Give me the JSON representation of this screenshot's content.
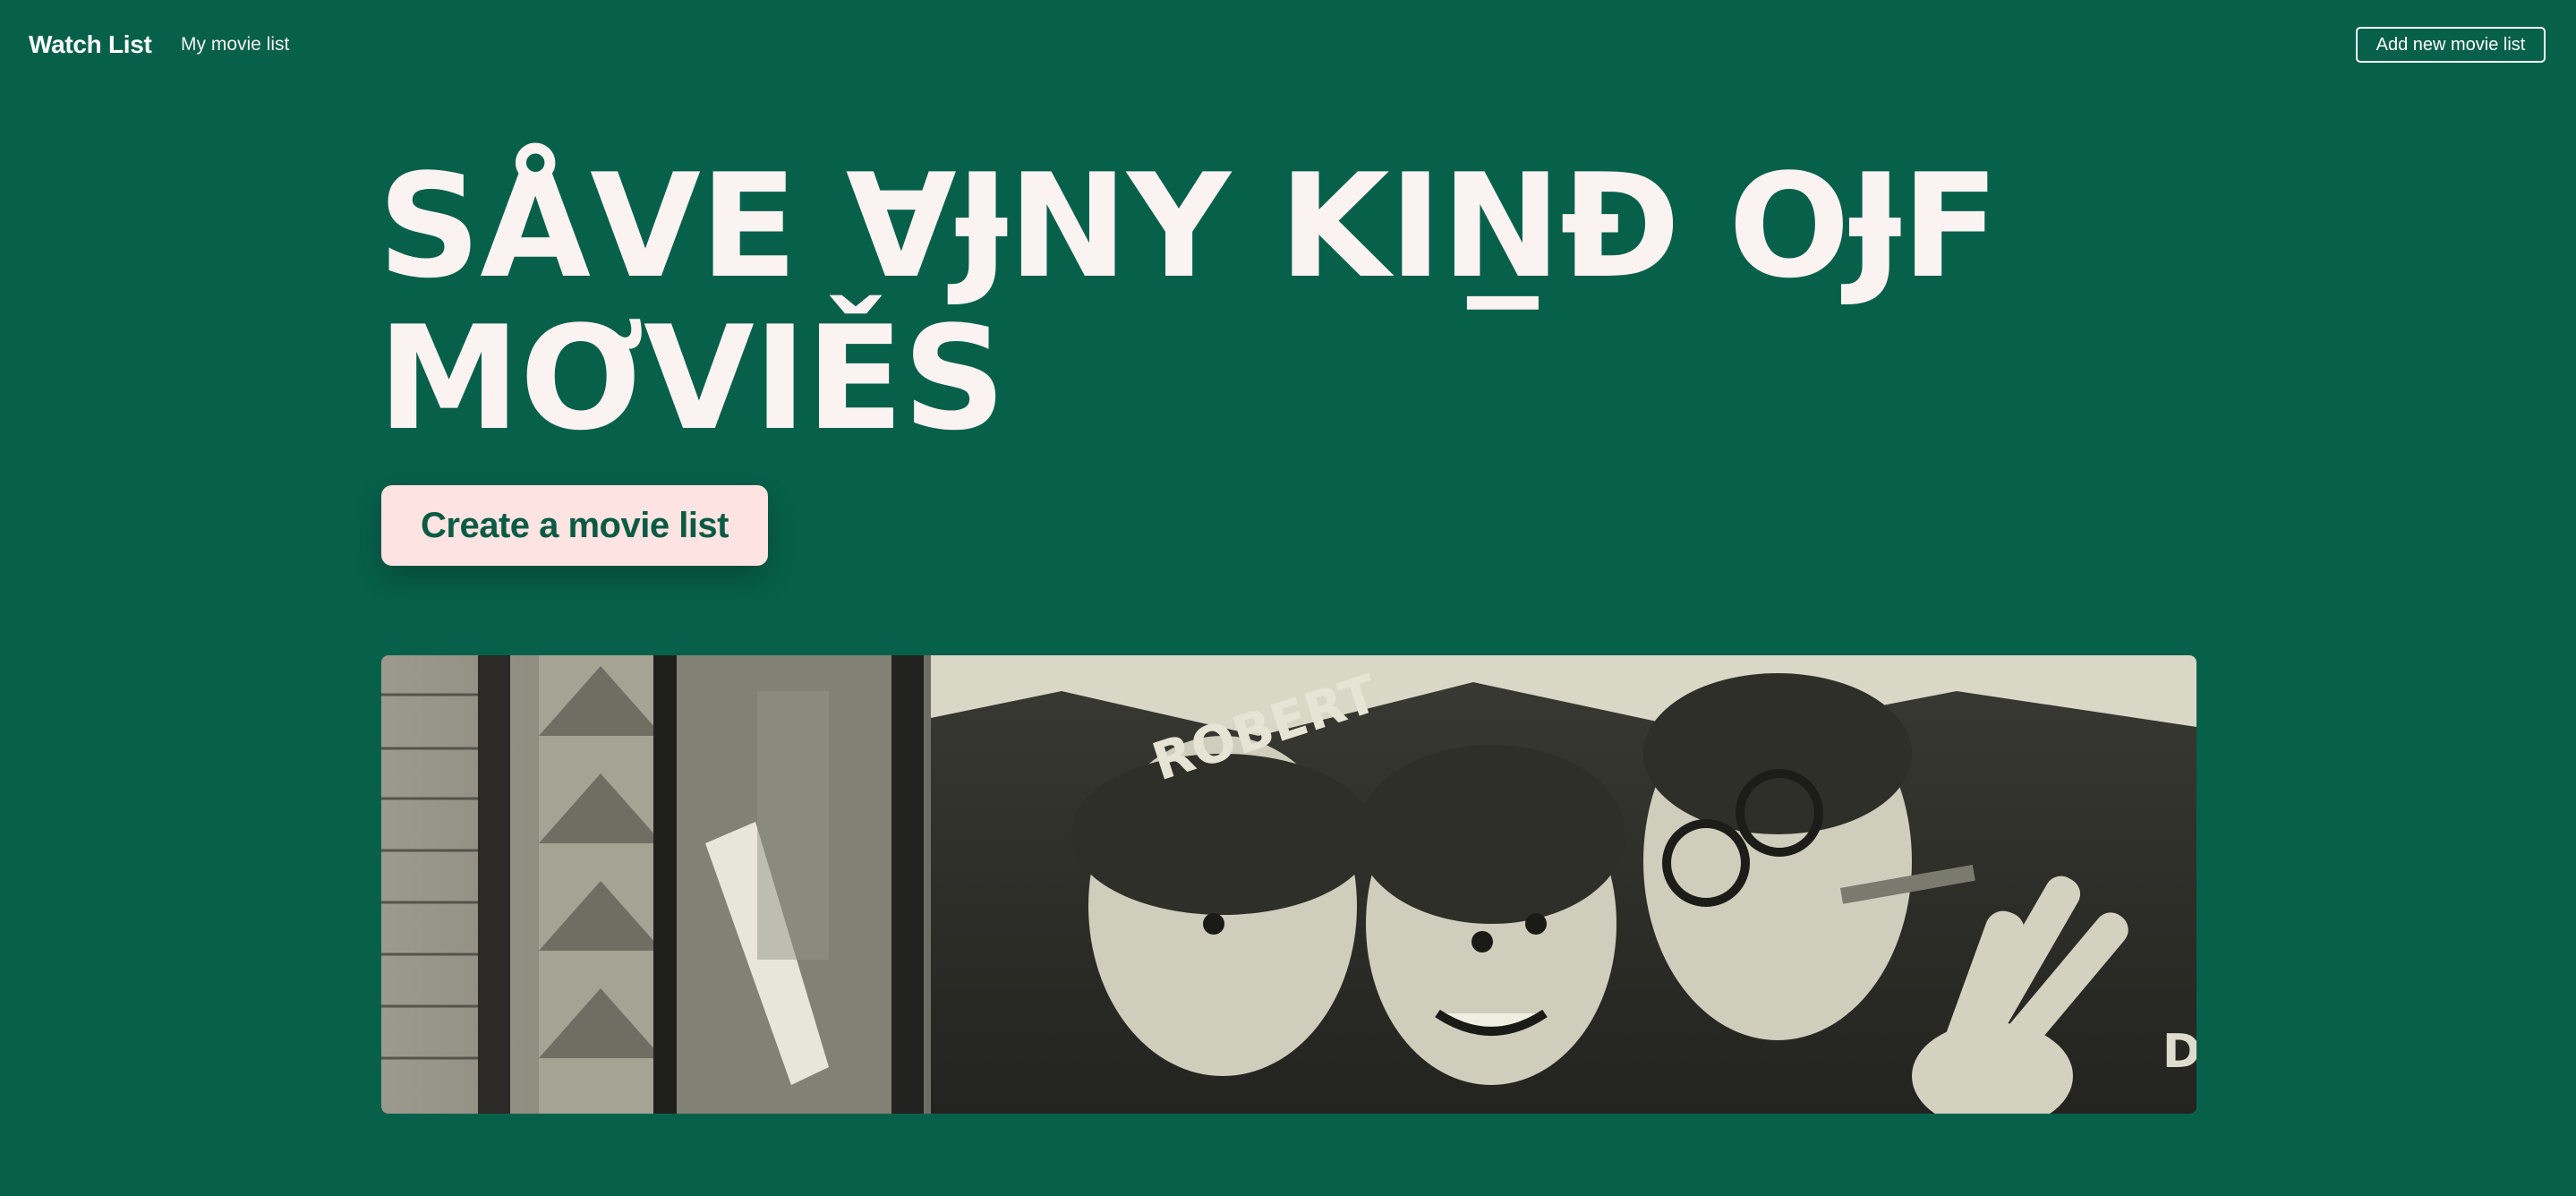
{
  "nav": {
    "brand": "Watch List",
    "link": "My movie list",
    "button": "Add new movie list"
  },
  "hero": {
    "headline": "SÅVE ∀ɈNY KIN̲Đ OɈF MƠVIĚS",
    "cta": "Create a movie list"
  },
  "image": {
    "poster_text": "ROBERT",
    "corner_text": "DO",
    "description_icon": "vintage-movie-poster-photo"
  },
  "colors": {
    "background": "#07604a",
    "cta_bg": "#fde4e2",
    "cta_text": "#0b5a44"
  }
}
